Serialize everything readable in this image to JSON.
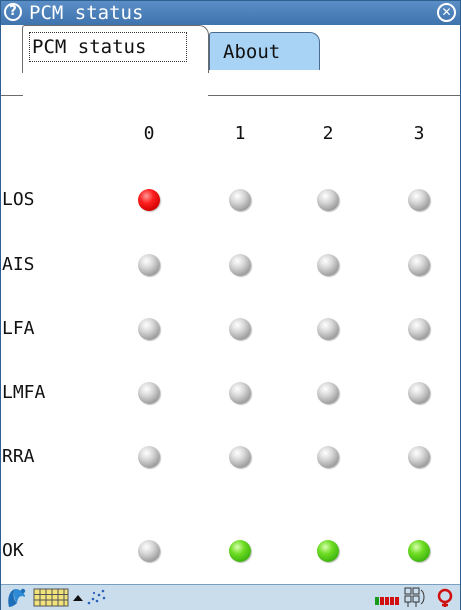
{
  "window": {
    "title": "PCM status",
    "help_icon": "?",
    "close_icon": "⊗"
  },
  "tabs": [
    {
      "label": "PCM status",
      "active": true
    },
    {
      "label": "About",
      "active": false
    }
  ],
  "columns": [
    "0",
    "1",
    "2",
    "3"
  ],
  "rows": [
    {
      "label": "LOS",
      "states": [
        "red",
        "grey",
        "grey",
        "grey"
      ]
    },
    {
      "label": "AIS",
      "states": [
        "grey",
        "grey",
        "grey",
        "grey"
      ]
    },
    {
      "label": "LFA",
      "states": [
        "grey",
        "grey",
        "grey",
        "grey"
      ]
    },
    {
      "label": "LMFA",
      "states": [
        "grey",
        "grey",
        "grey",
        "grey"
      ]
    },
    {
      "label": "RRA",
      "states": [
        "grey",
        "grey",
        "grey",
        "grey"
      ]
    },
    {
      "label": "OK",
      "states": [
        "grey",
        "green",
        "green",
        "green"
      ]
    }
  ],
  "colors": {
    "titlebar": "#4a7fbb",
    "tab_inactive": "#a9d3f5",
    "led_red": "#ff2020",
    "led_green": "#6edc22",
    "led_grey": "#bdbdbd",
    "taskbar": "#c9ddec"
  },
  "taskbar": {
    "icons": [
      "start-menu-icon",
      "keyboard-icon",
      "up-arrow-icon",
      "handwriting-icon",
      "signal-strength-icon",
      "network-icon",
      "power-icon"
    ]
  }
}
